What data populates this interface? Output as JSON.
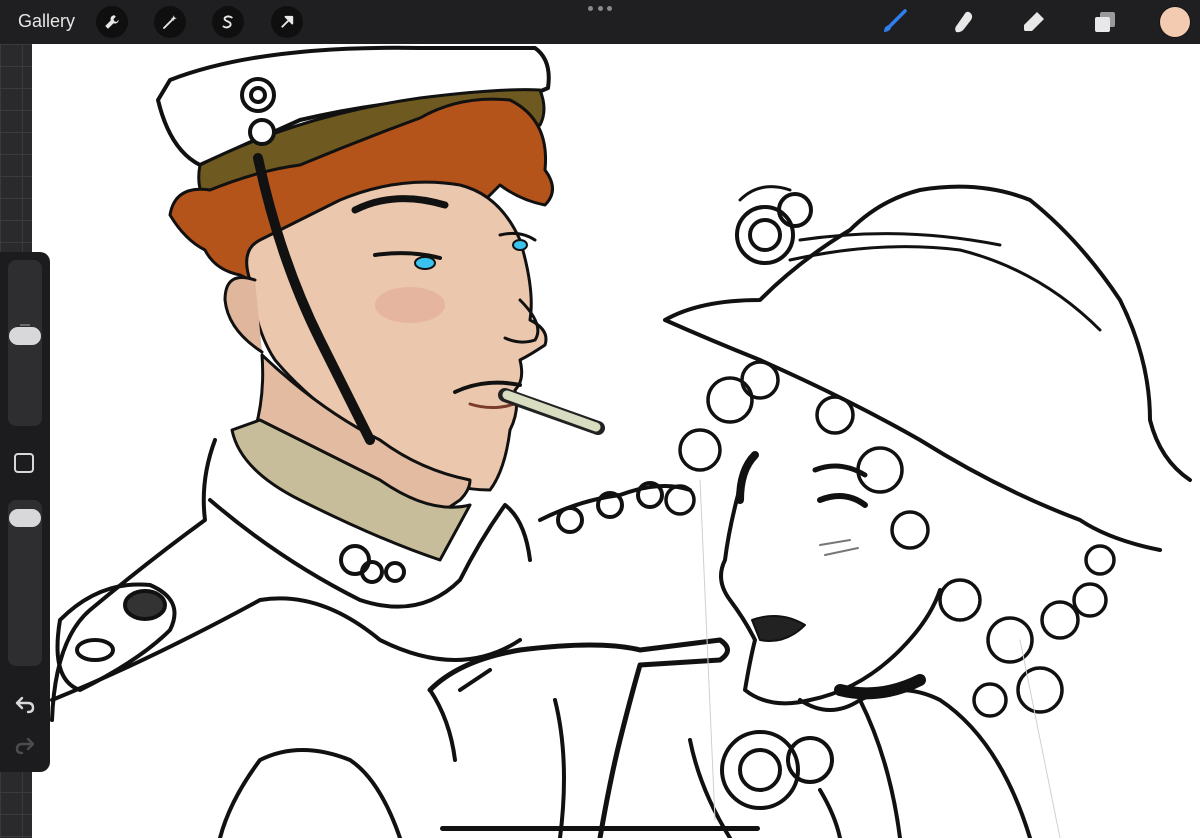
{
  "app": {
    "gallery_label": "Gallery"
  },
  "toolbar": {
    "left_tools": [
      "wrench-icon",
      "magic-wand-icon",
      "selection-s-icon",
      "transform-arrow-icon"
    ],
    "right_tools": [
      "brush-icon",
      "smudge-icon",
      "eraser-icon",
      "layers-icon"
    ],
    "active_tool": "brush-icon",
    "accent_color": "#2e7ff0",
    "current_color": "#f3cbb0"
  },
  "sidebar": {
    "brush_size_level": 0.55,
    "opacity_level": 0.95,
    "controls": [
      "brush-size-slider",
      "modify-button",
      "opacity-slider",
      "undo-icon",
      "redo-icon"
    ]
  },
  "canvas": {
    "background": "#ffffff",
    "palette": {
      "hair": "#b4531a",
      "cap_band": "#6e5a20",
      "skin": "#ebc7ae",
      "eyes": "#39c3ee",
      "collar": "#c7bd9b",
      "cigarette": "#d8dcc0",
      "ink": "#111111"
    }
  }
}
